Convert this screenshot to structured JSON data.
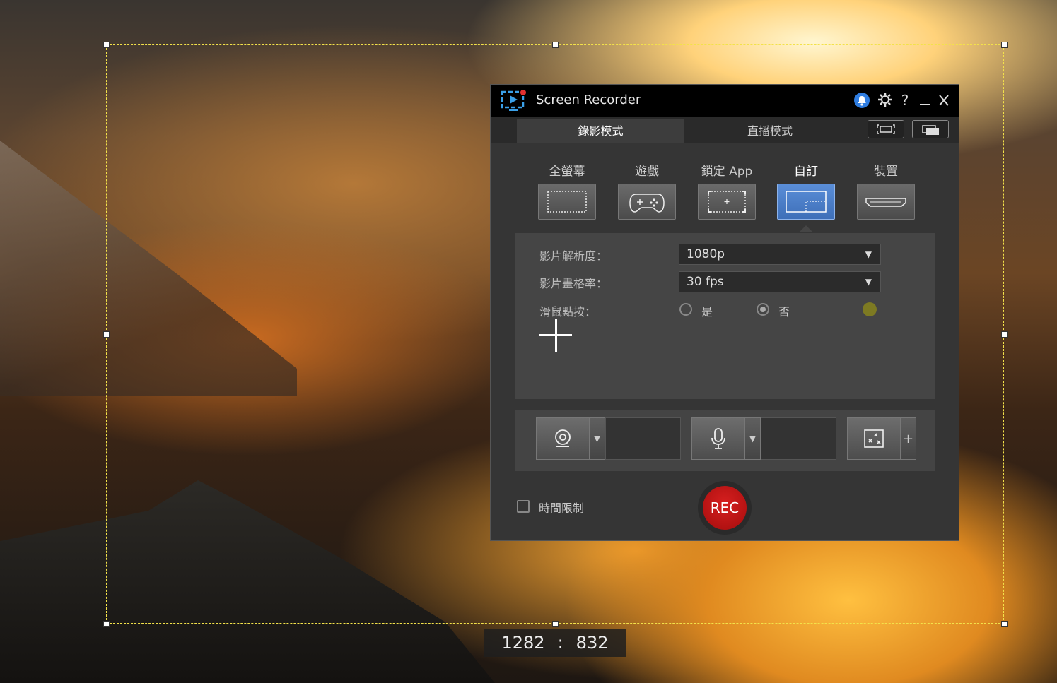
{
  "app": {
    "title": "Screen Recorder",
    "tabs": [
      "錄影模式",
      "直播模式"
    ]
  },
  "modes": [
    {
      "label": "全螢幕",
      "icon": "fullscreen-icon"
    },
    {
      "label": "遊戲",
      "icon": "gamepad-icon"
    },
    {
      "label": "鎖定 App",
      "icon": "lock-app-icon"
    },
    {
      "label": "自訂",
      "icon": "custom-area-icon",
      "selected": true
    },
    {
      "label": "裝置",
      "icon": "device-hdmi-icon"
    }
  ],
  "settings": {
    "resolution_label": "影片解析度：",
    "resolution_value": "1080p",
    "fps_label": "影片畫格率：",
    "fps_value": "30 fps",
    "mouse_click_label": "滑鼠點按：",
    "yes_label": "是",
    "no_label": "否",
    "mouse_click_selected": "否",
    "click_color": "#7d7a22"
  },
  "time_limit_label": "時間限制",
  "rec_label": "REC",
  "selection": {
    "width_text": "1282",
    "separator": ":",
    "height_text": "832",
    "frame_color": "#f3e24a"
  },
  "effects_add_label": "+"
}
